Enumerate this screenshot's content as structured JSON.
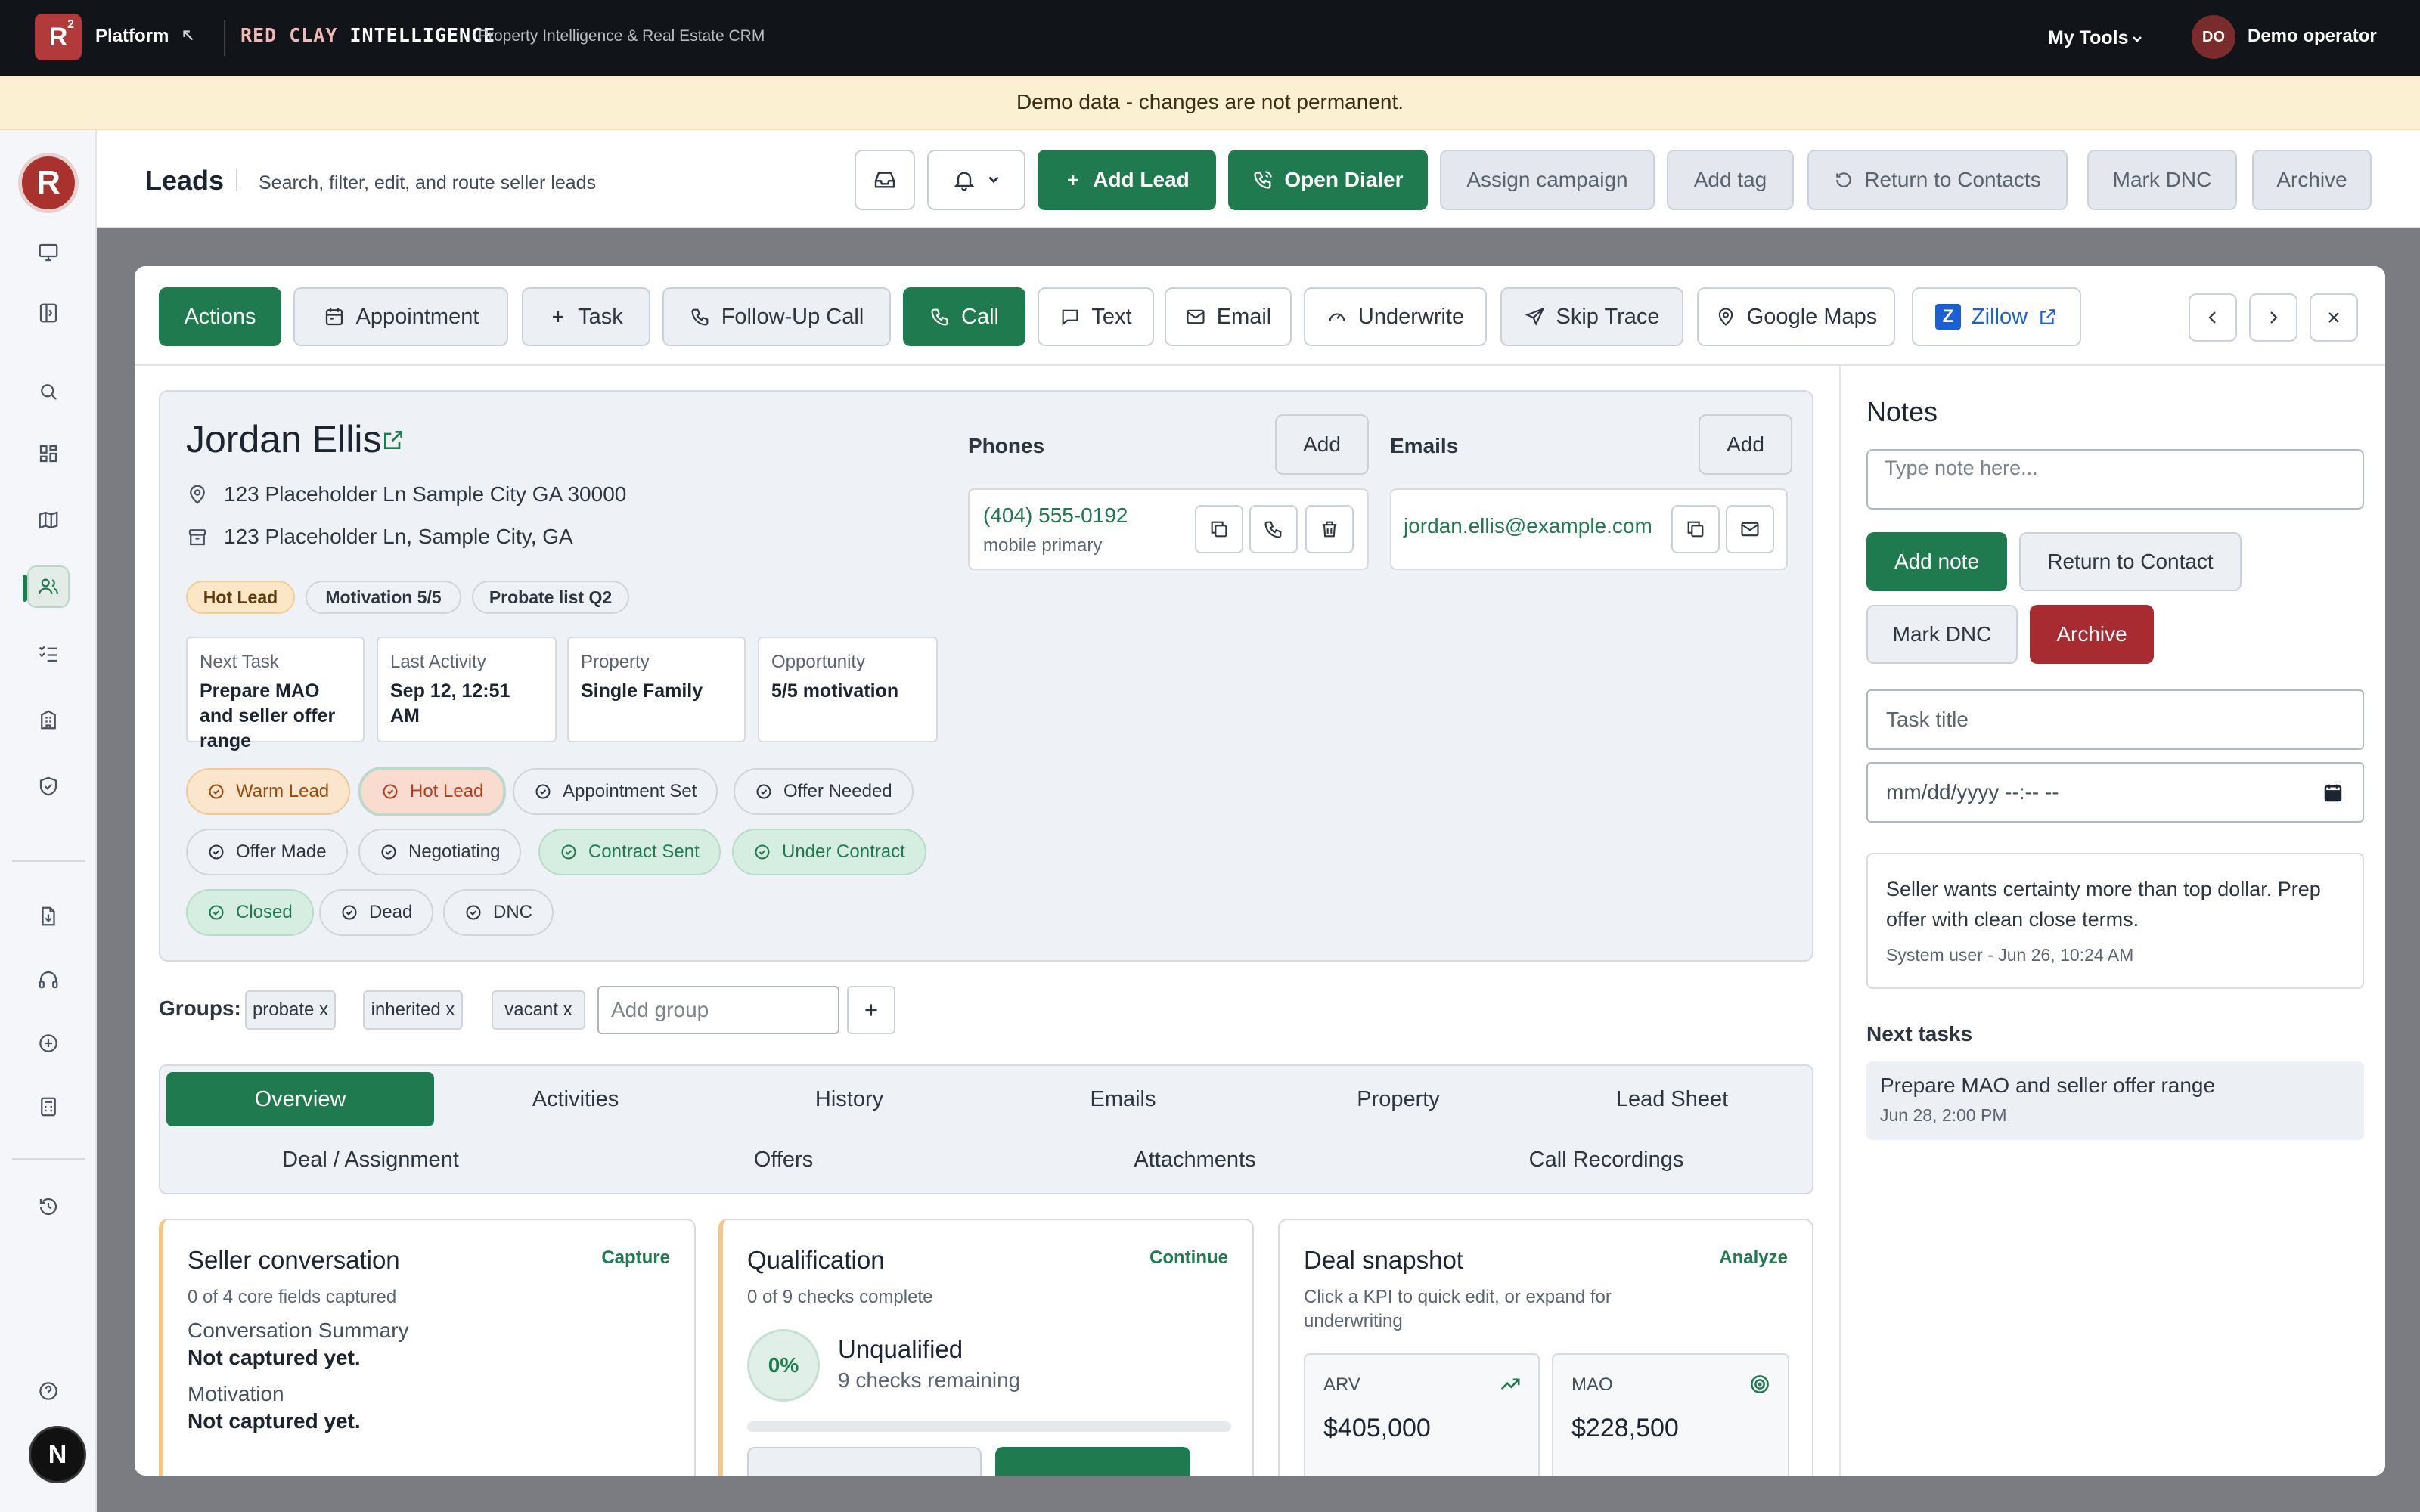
{
  "topbar": {
    "logo_letter": "R",
    "logo_sup": "2",
    "platform": "Platform",
    "brand_part1": "RED CLAY",
    "brand_part2": "INTELLIGENCE",
    "subtitle": "Property Intelligence & Real Estate CRM",
    "tools": "My Tools",
    "avatar_initials": "DO",
    "user": "Demo operator"
  },
  "banner": "Demo data - changes are not permanent.",
  "rail": {
    "bottom_initial": "N",
    "items": [
      "monitor",
      "sidebar",
      "search",
      "dashboard",
      "map",
      "leads",
      "tasks",
      "buildings",
      "shield",
      "document",
      "headset",
      "plus-circle",
      "calculator",
      "history",
      "help"
    ]
  },
  "header": {
    "title": "Leads",
    "subtitle": "Search, filter, edit, and route seller leads",
    "add_lead": "Add Lead",
    "open_dialer": "Open Dialer",
    "assign_campaign": "Assign campaign",
    "add_tag": "Add tag",
    "return_contacts": "Return to Contacts",
    "mark_dnc": "Mark DNC",
    "archive": "Archive"
  },
  "toolbar": {
    "actions": "Actions",
    "appointment": "Appointment",
    "task": "Task",
    "followup": "Follow-Up Call",
    "call": "Call",
    "text": "Text",
    "email": "Email",
    "underwrite": "Underwrite",
    "skip_trace": "Skip Trace",
    "google_maps": "Google Maps",
    "zillow_letter": "Z",
    "zillow": "Zillow"
  },
  "lead": {
    "name": "Jordan Ellis",
    "property_address": "123 Placeholder Ln Sample City GA 30000",
    "mailing_address": "123 Placeholder Ln, Sample City, GA",
    "pills": [
      "Hot Lead",
      "Motivation 5/5",
      "Probate list Q2"
    ],
    "kpis": [
      {
        "label": "Next Task",
        "value": "Prepare MAO and seller offer range"
      },
      {
        "label": "Last Activity",
        "value": "Sep 12, 12:51 AM"
      },
      {
        "label": "Property",
        "value": "Single Family"
      },
      {
        "label": "Opportunity",
        "value": "5/5 motivation"
      }
    ],
    "statuses": [
      "Warm Lead",
      "Hot Lead",
      "Appointment Set",
      "Offer Needed",
      "Offer Made",
      "Negotiating",
      "Contract Sent",
      "Under Contract",
      "Closed",
      "Dead",
      "DNC"
    ],
    "phones_label": "Phones",
    "emails_label": "Emails",
    "add": "Add",
    "phone": "(404) 555-0192",
    "phone_type": "mobile primary",
    "email": "jordan.ellis@example.com"
  },
  "groups": {
    "label": "Groups:",
    "tags": [
      "probate x",
      "inherited x",
      "vacant x"
    ],
    "placeholder": "Add group"
  },
  "tabs": [
    "Overview",
    "Activities",
    "History",
    "Emails",
    "Property",
    "Lead Sheet",
    "Deal / Assignment",
    "Offers",
    "Attachments",
    "Call Recordings"
  ],
  "cards": {
    "seller": {
      "title": "Seller conversation",
      "action": "Capture",
      "sub": "0 of 4 core fields captured",
      "f1_label": "Conversation Summary",
      "f1_value": "Not captured yet.",
      "f2_label": "Motivation",
      "f2_value": "Not captured yet."
    },
    "qual": {
      "title": "Qualification",
      "action": "Continue",
      "sub": "0 of 9 checks complete",
      "pct": "0%",
      "progress": 0,
      "status": "Unqualified",
      "remaining": "9 checks remaining"
    },
    "deal": {
      "title": "Deal snapshot",
      "action": "Analyze",
      "sub": "Click a KPI to quick edit, or expand for underwriting",
      "arv_label": "ARV",
      "arv_value": "$405,000",
      "mao_label": "MAO",
      "mao_value": "$228,500"
    }
  },
  "notes": {
    "title": "Notes",
    "placeholder": "Type note here...",
    "add_note": "Add note",
    "return_contact": "Return to Contact",
    "mark_dnc": "Mark DNC",
    "archive": "Archive",
    "task_placeholder": "Task title",
    "date_placeholder": "mm/dd/yyyy --:-- --",
    "note_text": "Seller wants certainty more than top dollar. Prep offer with clean close terms.",
    "note_meta": "System user - Jun 26, 10:24 AM",
    "next_title": "Next tasks",
    "task_name": "Prepare MAO and seller offer range",
    "task_date": "Jun 28, 2:00 PM"
  },
  "colors": {
    "accent": "#1f7a4f",
    "brand": "#b23a3a",
    "danger": "#a72b31",
    "banner": "#fbf1d2"
  }
}
